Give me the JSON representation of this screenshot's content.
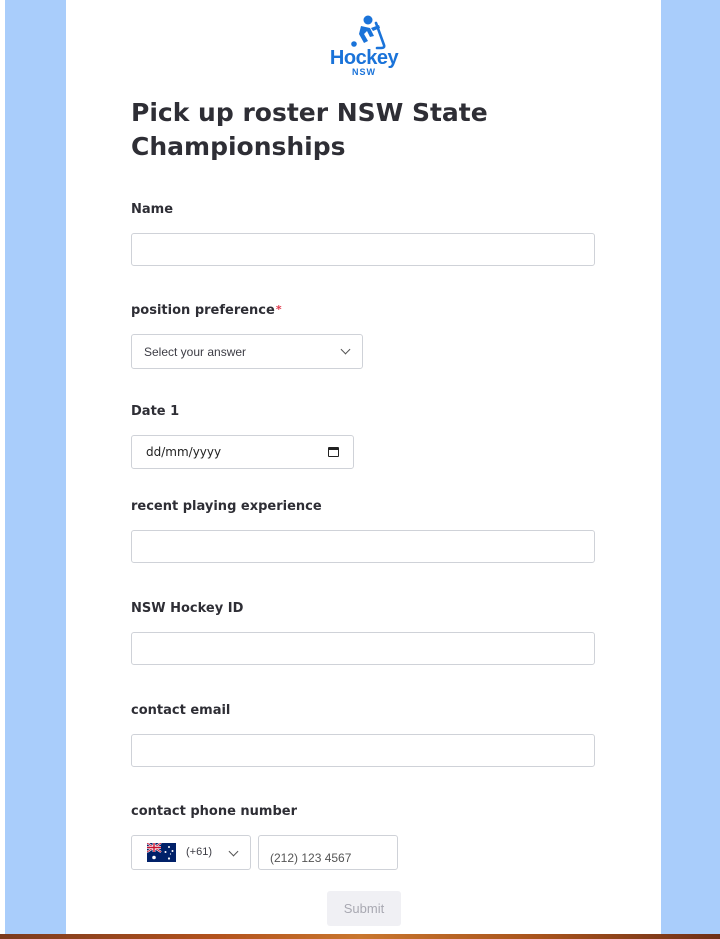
{
  "logo": {
    "word": "Hockey",
    "sub": "NSW"
  },
  "form": {
    "title": "Pick up roster NSW State Championships",
    "fields": {
      "name": {
        "label": "Name",
        "value": ""
      },
      "position": {
        "label": "position preference",
        "required_mark": "*",
        "selected": "Select your answer"
      },
      "date1": {
        "label": "Date 1",
        "value": "dd/mm/yyyy"
      },
      "experience": {
        "label": "recent playing experience",
        "value": ""
      },
      "hockey_id": {
        "label": "NSW Hockey ID",
        "value": ""
      },
      "email": {
        "label": "contact email",
        "value": ""
      },
      "phone": {
        "label": "contact phone number",
        "country_code": "(+61)",
        "placeholder": "(212) 123 4567"
      }
    },
    "submit_label": "Submit"
  },
  "colors": {
    "side_panel": "#a9cdfb",
    "brand_blue": "#1a73d9",
    "required_red": "#e0384b",
    "title_text": "#2e2e35"
  },
  "icons": [
    "hockey-player-icon",
    "chevron-down-icon",
    "calendar-icon",
    "australia-flag-icon"
  ]
}
